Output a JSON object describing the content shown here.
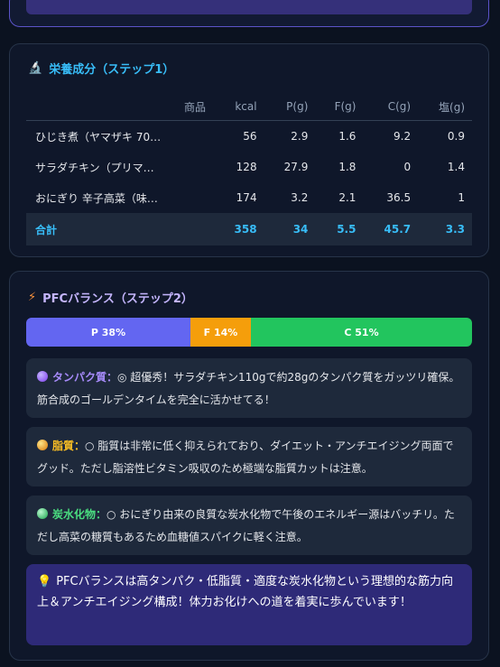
{
  "nutrition": {
    "title": "栄養成分（ステップ1）",
    "icon": "microscope-icon",
    "headers": [
      "商品",
      "kcal",
      "P(g)",
      "F(g)",
      "C(g)",
      "塩(g)"
    ],
    "rows": [
      {
        "name": "ひじき煮（ヤマザキ 70…",
        "kcal": "56",
        "p": "2.9",
        "f": "1.6",
        "c": "9.2",
        "salt": "0.9"
      },
      {
        "name": "サラダチキン（プリマ…",
        "kcal": "128",
        "p": "27.9",
        "f": "1.8",
        "c": "0",
        "salt": "1.4"
      },
      {
        "name": "おにぎり 辛子高菜（味…",
        "kcal": "174",
        "p": "3.2",
        "f": "2.1",
        "c": "36.5",
        "salt": "1"
      }
    ],
    "total": {
      "name": "合計",
      "kcal": "358",
      "p": "34",
      "f": "5.5",
      "c": "45.7",
      "salt": "3.3"
    }
  },
  "pfc": {
    "title": "PFCバランス（ステップ2）",
    "icon": "lightning-icon",
    "bar": [
      {
        "label": "P 38%",
        "percent": 38,
        "color": "#6366f1"
      },
      {
        "label": "F 14%",
        "percent": 14,
        "color": "#f59e0b"
      },
      {
        "label": "C 51%",
        "percent": 51,
        "color": "#22c55e"
      }
    ],
    "notes": {
      "protein": {
        "label": "タンパク質：",
        "text": "◎ 超優秀！サラダチキン110gで約28gのタンパク質をガッツリ確保。筋合成のゴールデンタイムを完全に活かせてる！"
      },
      "fat": {
        "label": "脂質：",
        "text": "○ 脂質は非常に低く抑えられており、ダイエット・アンチエイジング両面でグッド。ただし脂溶性ビタミン吸収のため極端な脂質カットは注意。"
      },
      "carb": {
        "label": "炭水化物：",
        "text": "○ おにぎり由来の良質な炭水化物で午後のエネルギー源はバッチリ。ただし高菜の糖質もあるため血糖値スパイクに軽く注意。"
      }
    },
    "summary": "PFCバランスは高タンパク・低脂質・適度な炭水化物という理想的な筋力向上＆アンチエイジング構成！体力お化けへの道を着実に歩んでいます！"
  }
}
